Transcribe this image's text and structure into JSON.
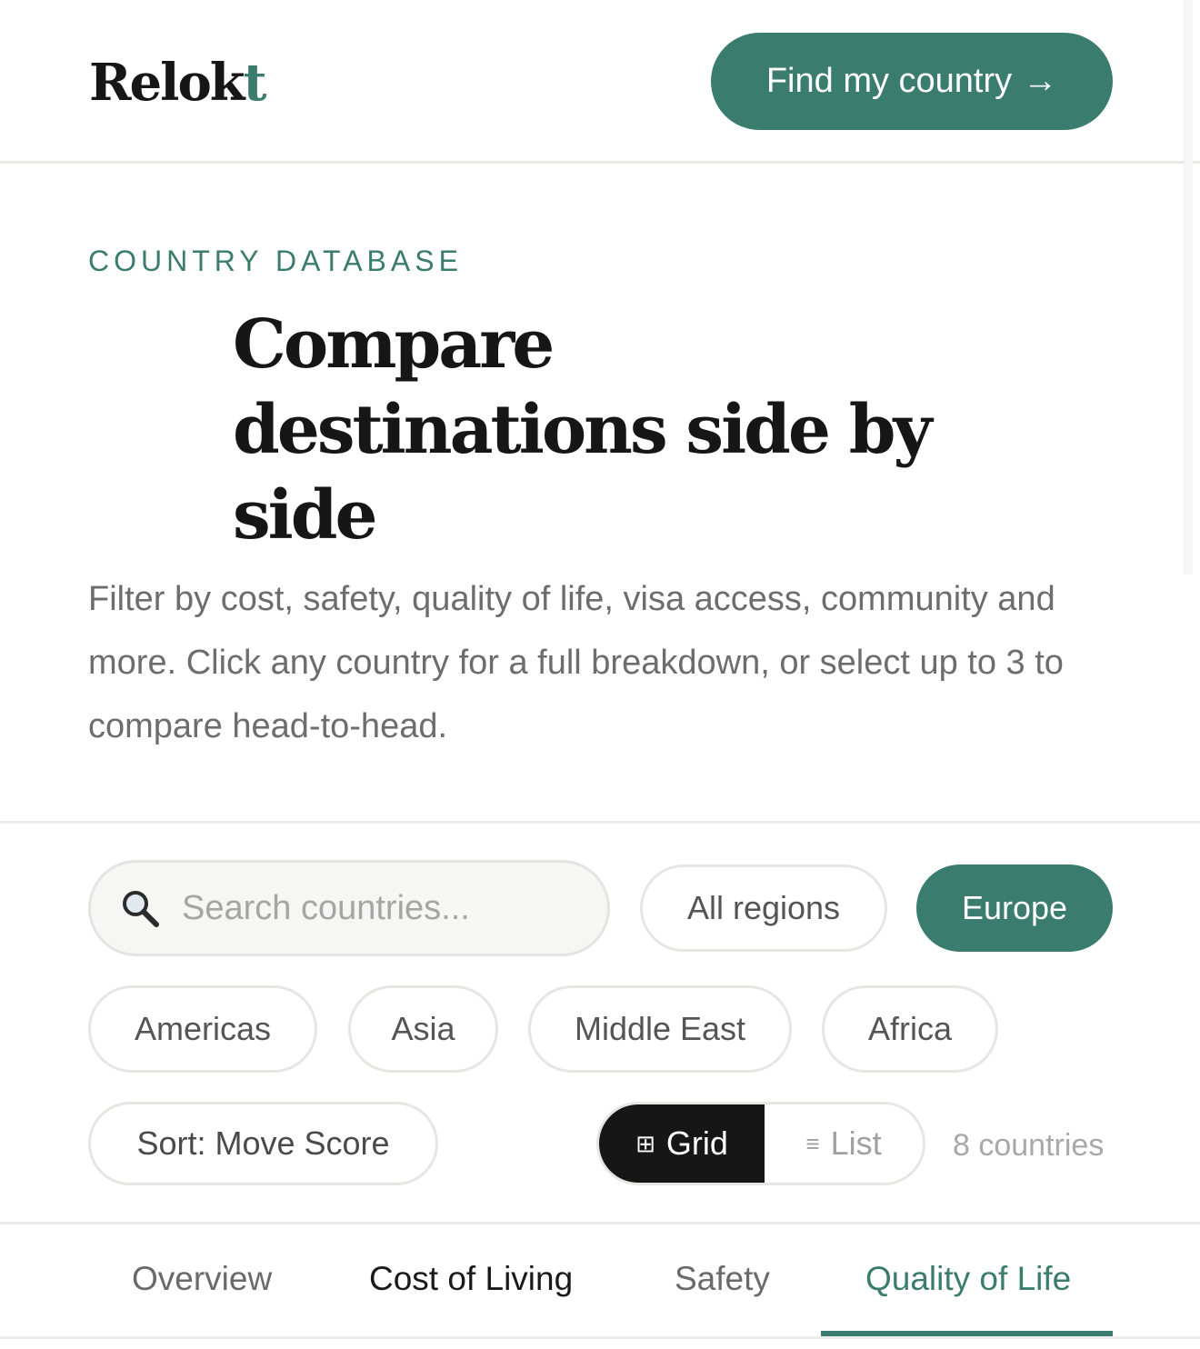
{
  "header": {
    "logo_main": "Relok",
    "logo_accent": "t",
    "cta_label": "Find my country",
    "cta_arrow": "→"
  },
  "hero": {
    "eyebrow": "COUNTRY DATABASE",
    "title_line1": "Compare",
    "title_line2": "destinations side by",
    "title_line3": "side",
    "description": "Filter by cost, safety, quality of life, visa access, community and more. Click any country for a full breakdown, or select up to 3 to compare head-to-head."
  },
  "filters": {
    "search_placeholder": "Search countries...",
    "search_icon": "search-icon",
    "regions": [
      "All regions",
      "Europe",
      "Americas",
      "Asia",
      "Middle East",
      "Africa"
    ],
    "active_region": "Europe",
    "sort_label": "Sort: Move Score",
    "view_grid_icon": "⊞",
    "view_grid": "Grid",
    "view_list_icon": "≡",
    "view_list": "List",
    "active_view": "Grid",
    "count": "8 countries"
  },
  "tabs": {
    "items": [
      "Overview",
      "Cost of Living",
      "Safety",
      "Quality of Life"
    ],
    "active": "Quality of Life"
  },
  "colors": {
    "accent": "#3a7c6d",
    "dark": "#161616",
    "muted": "#6d6d6d"
  }
}
